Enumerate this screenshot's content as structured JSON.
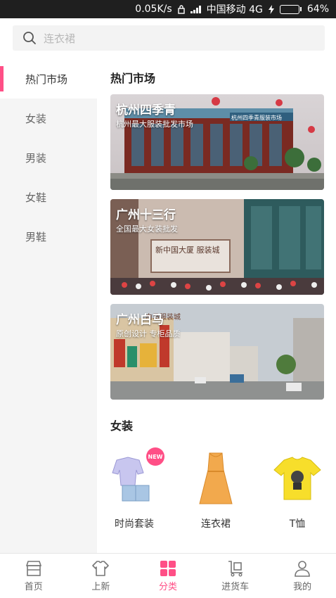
{
  "status_bar": {
    "speed": "0.05K/s",
    "carrier": "中国移动 4G",
    "battery": "64%",
    "battery_level": 0.64
  },
  "search": {
    "placeholder": "连衣裙"
  },
  "sidebar": {
    "items": [
      {
        "label": "热门市场",
        "active": true
      },
      {
        "label": "女装"
      },
      {
        "label": "男装"
      },
      {
        "label": "女鞋"
      },
      {
        "label": "男鞋"
      }
    ]
  },
  "hot_markets": {
    "title": "热门市场",
    "banners": [
      {
        "name": "杭州四季青",
        "subtitle": "杭州最大服装批发市场",
        "sign": "杭州四季青服装市场"
      },
      {
        "name": "广州十三行",
        "subtitle": "全国最大女装批发",
        "sign": "新中国大厦 服装城"
      },
      {
        "name": "广州白马",
        "subtitle": "原创设计 专柜品质",
        "sign": "白马服装城"
      }
    ]
  },
  "womens": {
    "title": "女装",
    "products": [
      {
        "label": "时尚套装",
        "badge": "NEW"
      },
      {
        "label": "连衣裙"
      },
      {
        "label": "T恤"
      }
    ]
  },
  "tabbar": {
    "tabs": [
      {
        "label": "首页",
        "icon": "store-icon"
      },
      {
        "label": "上新",
        "icon": "tshirt-icon"
      },
      {
        "label": "分类",
        "icon": "grid-icon",
        "active": true
      },
      {
        "label": "进货车",
        "icon": "cart-icon"
      },
      {
        "label": "我的",
        "icon": "user-icon"
      }
    ]
  },
  "colors": {
    "accent": "#ff4f86",
    "sidebar_bg": "#f5f5f5"
  }
}
